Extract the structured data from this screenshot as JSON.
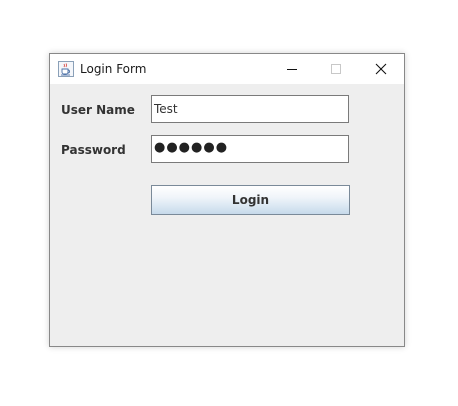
{
  "window": {
    "title": "Login Form",
    "icons": {
      "app": "java-cup-icon",
      "minimize": "minimize-icon",
      "maximize": "maximize-icon",
      "close": "close-icon"
    }
  },
  "form": {
    "username_label": "User Name",
    "username_value": "Test",
    "password_label": "Password",
    "password_masked": "●●●●●●",
    "login_label": "Login"
  },
  "colors": {
    "window_background": "#eeeeee",
    "titlebar_background": "#ffffff",
    "button_gradient_bottom": "#c6d9eb"
  }
}
